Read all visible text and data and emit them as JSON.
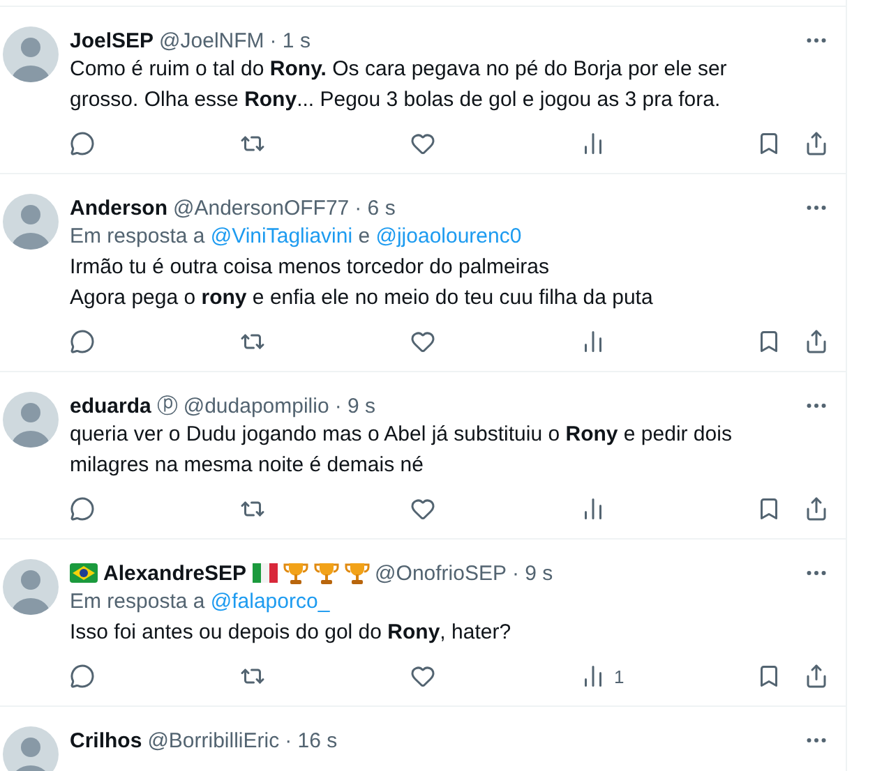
{
  "tweets": [
    {
      "name": "JoelSEP",
      "handle": "@JoelNFM",
      "time": "· 1 s",
      "text": "Como é ruim o tal do **Rony.** Os cara pegava no pé do Borja por ele ser grosso. Olha esse **Rony**... Pegou 3 bolas de gol e jogou as 3 pra fora."
    },
    {
      "name": "Anderson",
      "handle": "@AndersonOFF77",
      "time": "· 6 s",
      "reply_to": {
        "prefix": "Em resposta a",
        "mentions": [
          "@ViniTagliavini",
          "@jjoaolourenc0"
        ],
        "joiner": "e"
      },
      "text": "Irmão tu é outra coisa menos torcedor do palmeiras\nAgora pega o **rony** e enfia ele no meio do teu cuu filha da puta"
    },
    {
      "name": "eduarda",
      "name_symbol": "ⓟ",
      "handle": "@dudapompilio",
      "time": "· 9 s",
      "text": "queria ver o Dudu jogando mas o Abel já substituiu o **Rony** e pedir dois milagres na mesma noite é demais né"
    },
    {
      "name": "AlexandreSEP",
      "badges_before": [
        {
          "kind": "brazil-flag"
        }
      ],
      "badges_after": [
        {
          "kind": "italy-flag"
        },
        {
          "kind": "trophy"
        },
        {
          "kind": "trophy"
        },
        {
          "kind": "trophy"
        }
      ],
      "handle": "@OnofrioSEP",
      "time": "· 9 s",
      "reply_to": {
        "prefix": "Em resposta a",
        "mentions": [
          "@falaporco_"
        ]
      },
      "text": "Isso foi antes ou depois do gol do **Rony**, hater?",
      "views": "1"
    },
    {
      "name": "Crilhos",
      "handle": "@BorribilliEric",
      "time": "· 16 s"
    }
  ]
}
